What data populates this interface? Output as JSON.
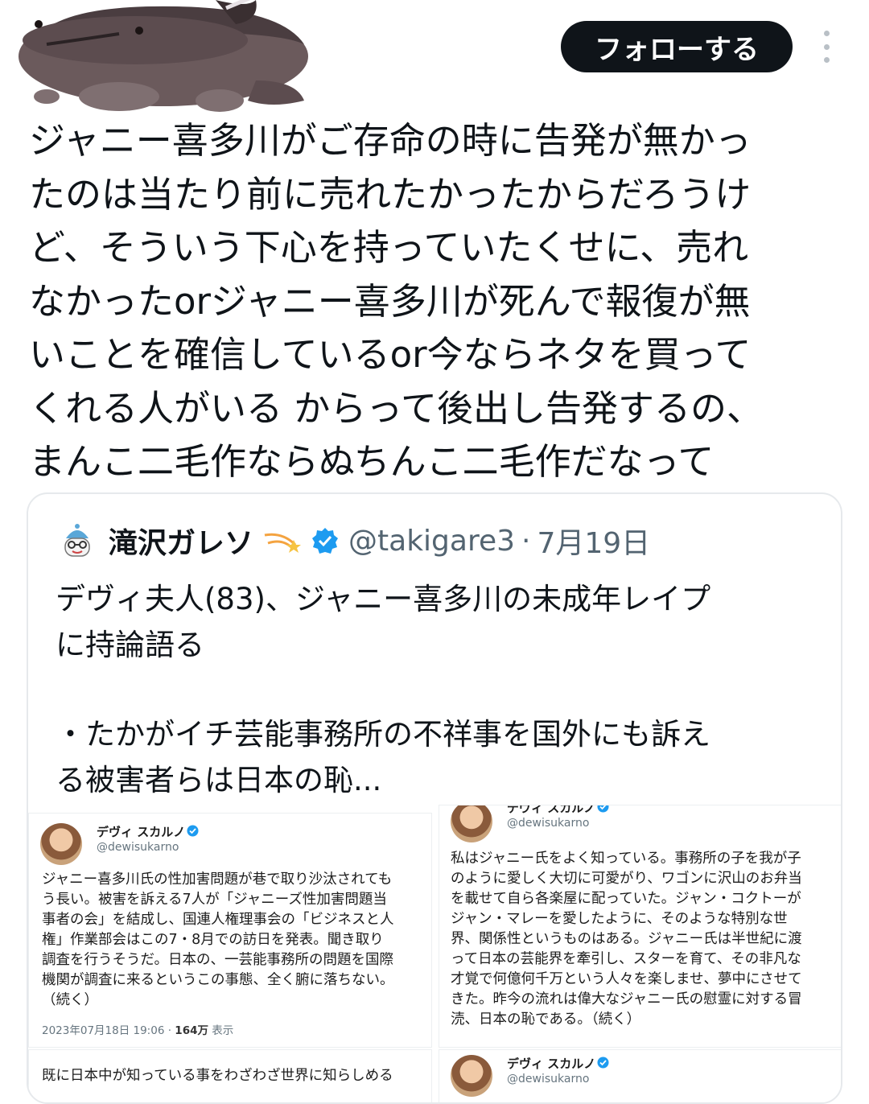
{
  "header": {
    "follow_label": "フォローする"
  },
  "tweet": {
    "lines": [
      "ジャニー喜多川がご存命の時に告発が無かっ",
      "たのは当たり前に売れたかったからだろうけ",
      "ど、そういう下心を持っていたくせに、売れ",
      "なかったorジャニー喜多川が死んで報復が無",
      "いことを確信しているor今ならネタを買って",
      "くれる人がいる からって後出し告発するの、",
      "まんこ二毛作ならぬちんこ二毛作だなって"
    ]
  },
  "quote": {
    "name": "滝沢ガレソ",
    "handle": "@takigare3",
    "separator": "·",
    "date": "7月19日",
    "lines": [
      "デヴィ夫人(83)、ジャニー喜多川の未成年レイプ",
      "に持論語る",
      "・たかがイチ芸能事務所の不祥事を国外にも訴え",
      "る被害者らは日本の恥..."
    ],
    "images": [
      {
        "name": "デヴィ スカルノ",
        "handle": "@dewisukarno",
        "lines": [
          "ジャニー喜多川氏の性加害問題が巷で取り沙汰されても",
          "う長い。被害を訴える7人が「ジャニーズ性加害問題当",
          "事者の会」を結成し、国連人権理事会の「ビジネスと人",
          "権」作業部会はこの7・8月での訪日を発表。聞き取り",
          "調査を行うそうだ。日本の、一芸能事務所の問題を国際",
          "機関が調査に来るというこの事態、全く腑に落ちない。",
          "（続く）"
        ],
        "timestamp": "2023年07月18日 19:06 ·",
        "views": "164万",
        "views_label": "表示"
      },
      {
        "name": "デヴィ スカルノ",
        "handle": "@dewisukarno",
        "lines": [
          "私はジャニー氏をよく知っている。事務所の子を我が子",
          "のように愛しく大切に可愛がり、ワゴンに沢山のお弁当",
          "を載せて自ら各楽屋に配っていた。ジャン・コクトーが",
          "ジャン・マレーを愛したように、そのような特別な世",
          "界、関係性というものはある。ジャニー氏は半世紀に渡",
          "って日本の芸能界を牽引し、スターを育て、その非凡な",
          "才覚で何億何千万という人々を楽しませ、夢中にさせて",
          "きた。昨今の流れは偉大なジャニー氏の慰霊に対する冒",
          "涜、日本の恥である。（続く）"
        ]
      },
      {
        "lines": [
          "既に日本中が知っている事をわざわざ世界に知らしめる"
        ]
      },
      {
        "name": "デヴィ スカルノ",
        "handle": "@dewisukarno"
      }
    ]
  }
}
